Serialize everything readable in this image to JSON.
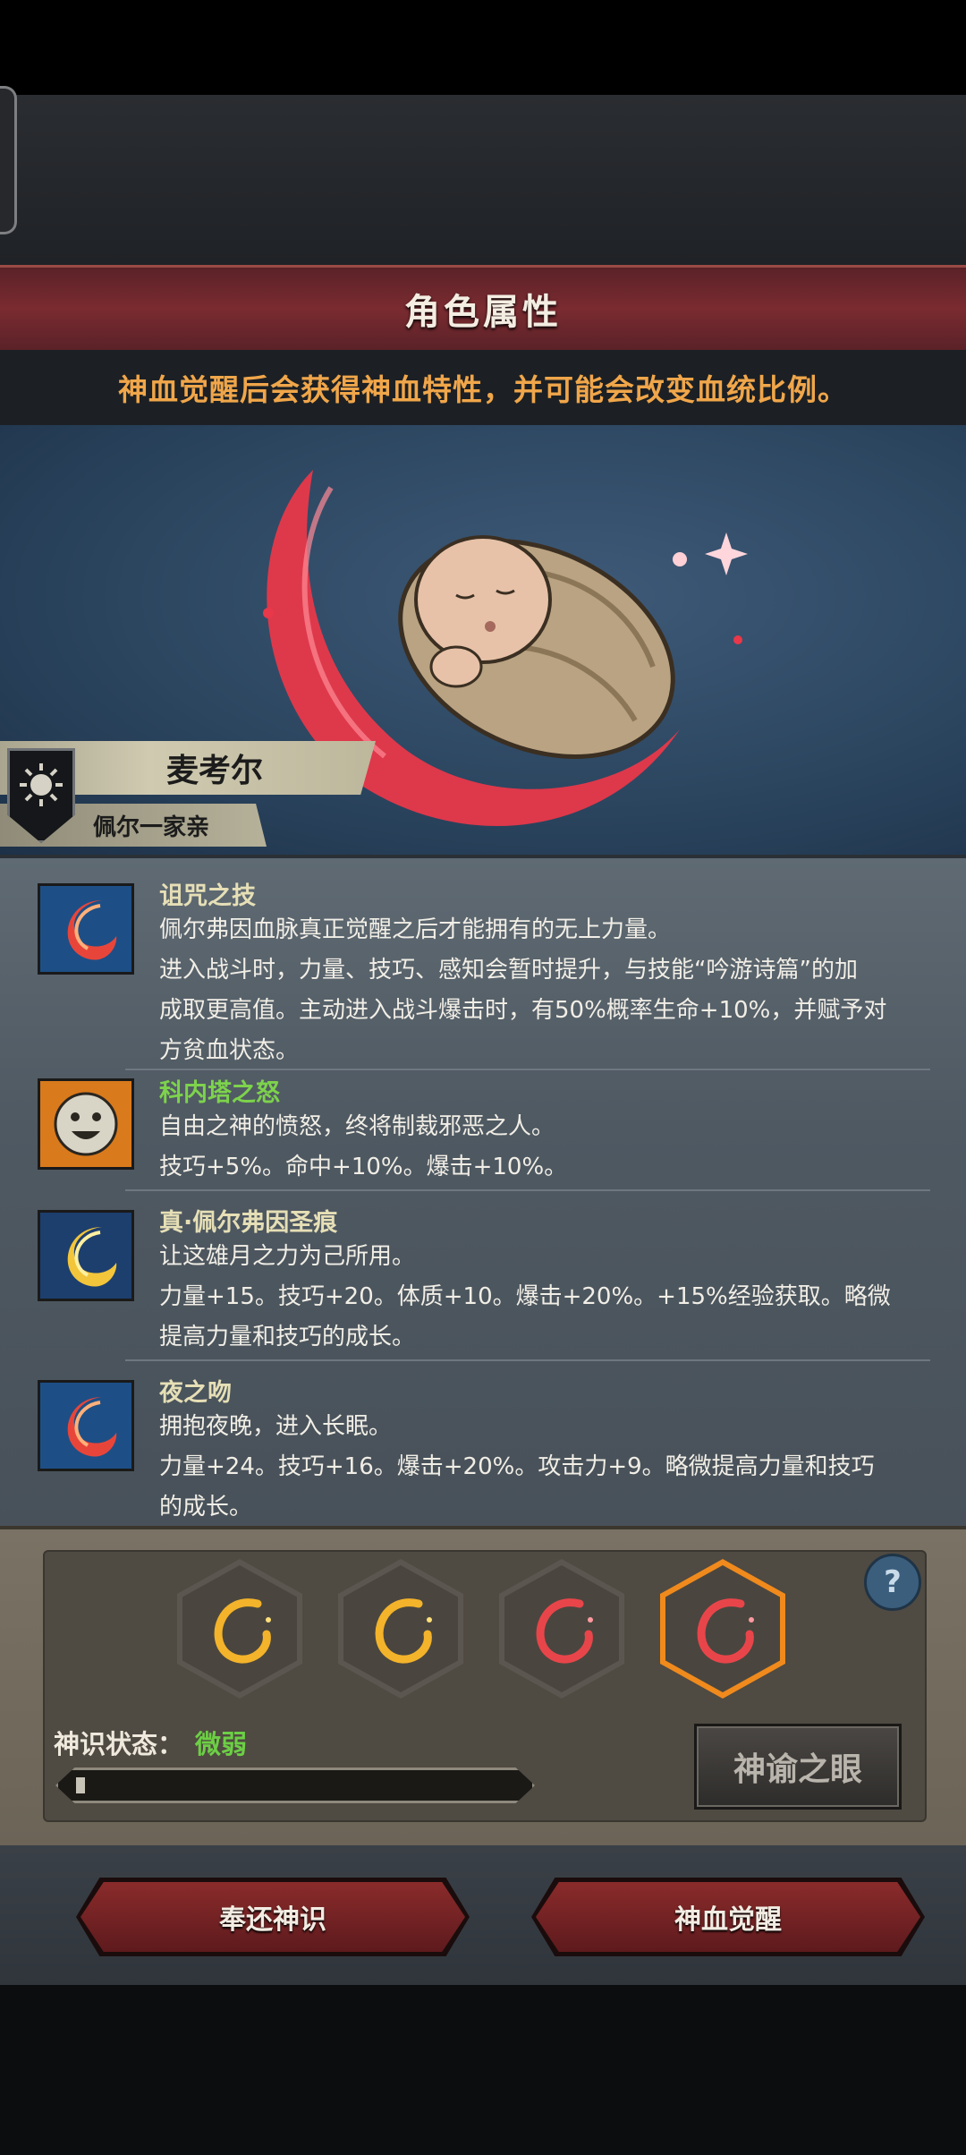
{
  "header": {
    "title": "角色属性",
    "subtitle": "神血觉醒后会获得神血特性，并可能会改变血统比例。"
  },
  "character": {
    "name": "麦考尔",
    "family": "佩尔一家亲"
  },
  "traits": [
    {
      "title": "诅咒之技",
      "title_color": "#e6dfb6",
      "icon": "red-crescent-icon",
      "lines": [
        "佩尔弗因血脉真正觉醒之后才能拥有的无上力量。",
        "进入战斗时，力量、技巧、感知会暂时提升，与技能“吟游诗篇”的加",
        "成取更高值。主动进入战斗爆击时，有50%概率生命+10%，并赋予对",
        "方贫血状态。"
      ]
    },
    {
      "title": "科内塔之怒",
      "title_color": "#7dd34c",
      "icon": "smiling-face-icon",
      "lines": [
        "自由之神的愤怒，终将制裁邪恶之人。",
        "技巧+5%。命中+10%。爆击+10%。"
      ]
    },
    {
      "title": "真·佩尔弗因圣痕",
      "title_color": "#e6dfb6",
      "icon": "gold-crescent-icon",
      "lines": [
        "让这雄月之力为己所用。",
        "力量+15。技巧+20。体质+10。爆击+20%。+15%经验获取。略微",
        "提高力量和技巧的成长。"
      ]
    },
    {
      "title": "夜之吻",
      "title_color": "#e6dfb6",
      "icon": "red-crescent-icon",
      "lines": [
        "拥抱夜晚，进入长眠。",
        "力量+24。技巧+16。爆击+20%。攻击力+9。略微提高力量和技巧",
        "的成长。"
      ]
    }
  ],
  "divinity_slots": [
    {
      "icon": "gold-swirl-icon",
      "color": "#f3b32a",
      "active": false
    },
    {
      "icon": "gold-swirl-icon",
      "color": "#f3b32a",
      "active": false
    },
    {
      "icon": "red-swirl-icon",
      "color": "#e8454a",
      "active": false
    },
    {
      "icon": "red-swirl-icon",
      "color": "#e8454a",
      "active": true
    }
  ],
  "status": {
    "label": "神识状态：",
    "value": "微弱",
    "progress": 0.02
  },
  "buttons": {
    "help": "?",
    "oracle_eye": "神谕之眼",
    "return": "奉还神识",
    "awaken": "神血觉醒"
  },
  "colors": {
    "accent_red": "#7a2b30",
    "subtitle_orange": "#f0a64a",
    "status_green": "#6ccf45",
    "active_slot": "#f08a1c"
  }
}
